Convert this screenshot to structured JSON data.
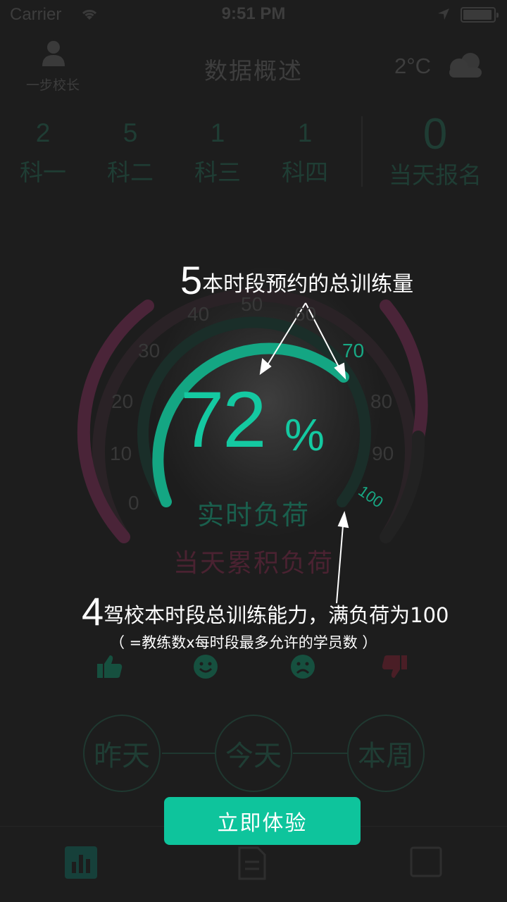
{
  "status_bar": {
    "carrier": "Carrier",
    "time": "9:51 PM"
  },
  "header": {
    "user_label": "一步校长",
    "title": "数据概述",
    "temperature": "2°C",
    "weather_icon": "cloud-icon"
  },
  "stats": [
    {
      "value": "2",
      "label": "科一"
    },
    {
      "value": "5",
      "label": "科二"
    },
    {
      "value": "1",
      "label": "科三"
    },
    {
      "value": "1",
      "label": "科四"
    },
    {
      "value": "0",
      "label": "当天报名"
    }
  ],
  "gauge": {
    "percent": "72",
    "percent_sign": "%",
    "realtime_label": "实时负荷",
    "cumulative_label": "当天累积负荷",
    "ticks": [
      "0",
      "10",
      "20",
      "30",
      "40",
      "50",
      "60",
      "70",
      "80",
      "90",
      "100"
    ],
    "realtime_fraction": 0.72,
    "colors": {
      "accent": "#14c9a1",
      "cumulative": "#5a2440"
    }
  },
  "callouts": {
    "c5": {
      "number": "5",
      "text": "本时段预约的总训练量"
    },
    "c4": {
      "number": "4",
      "text": "驾校本时段总训练能力，满负荷为100",
      "subtext": "（ =教练数x每时段最多允许的学员数 ）"
    }
  },
  "reactions": [
    "thumbs-up-icon",
    "happy-face-icon",
    "sad-face-icon",
    "thumbs-down-icon"
  ],
  "periods": [
    "昨天",
    "今天",
    "本周"
  ],
  "cta": {
    "label": "立即体验"
  },
  "tabs": [
    "bar-chart-icon",
    "document-icon",
    "square-icon"
  ]
}
